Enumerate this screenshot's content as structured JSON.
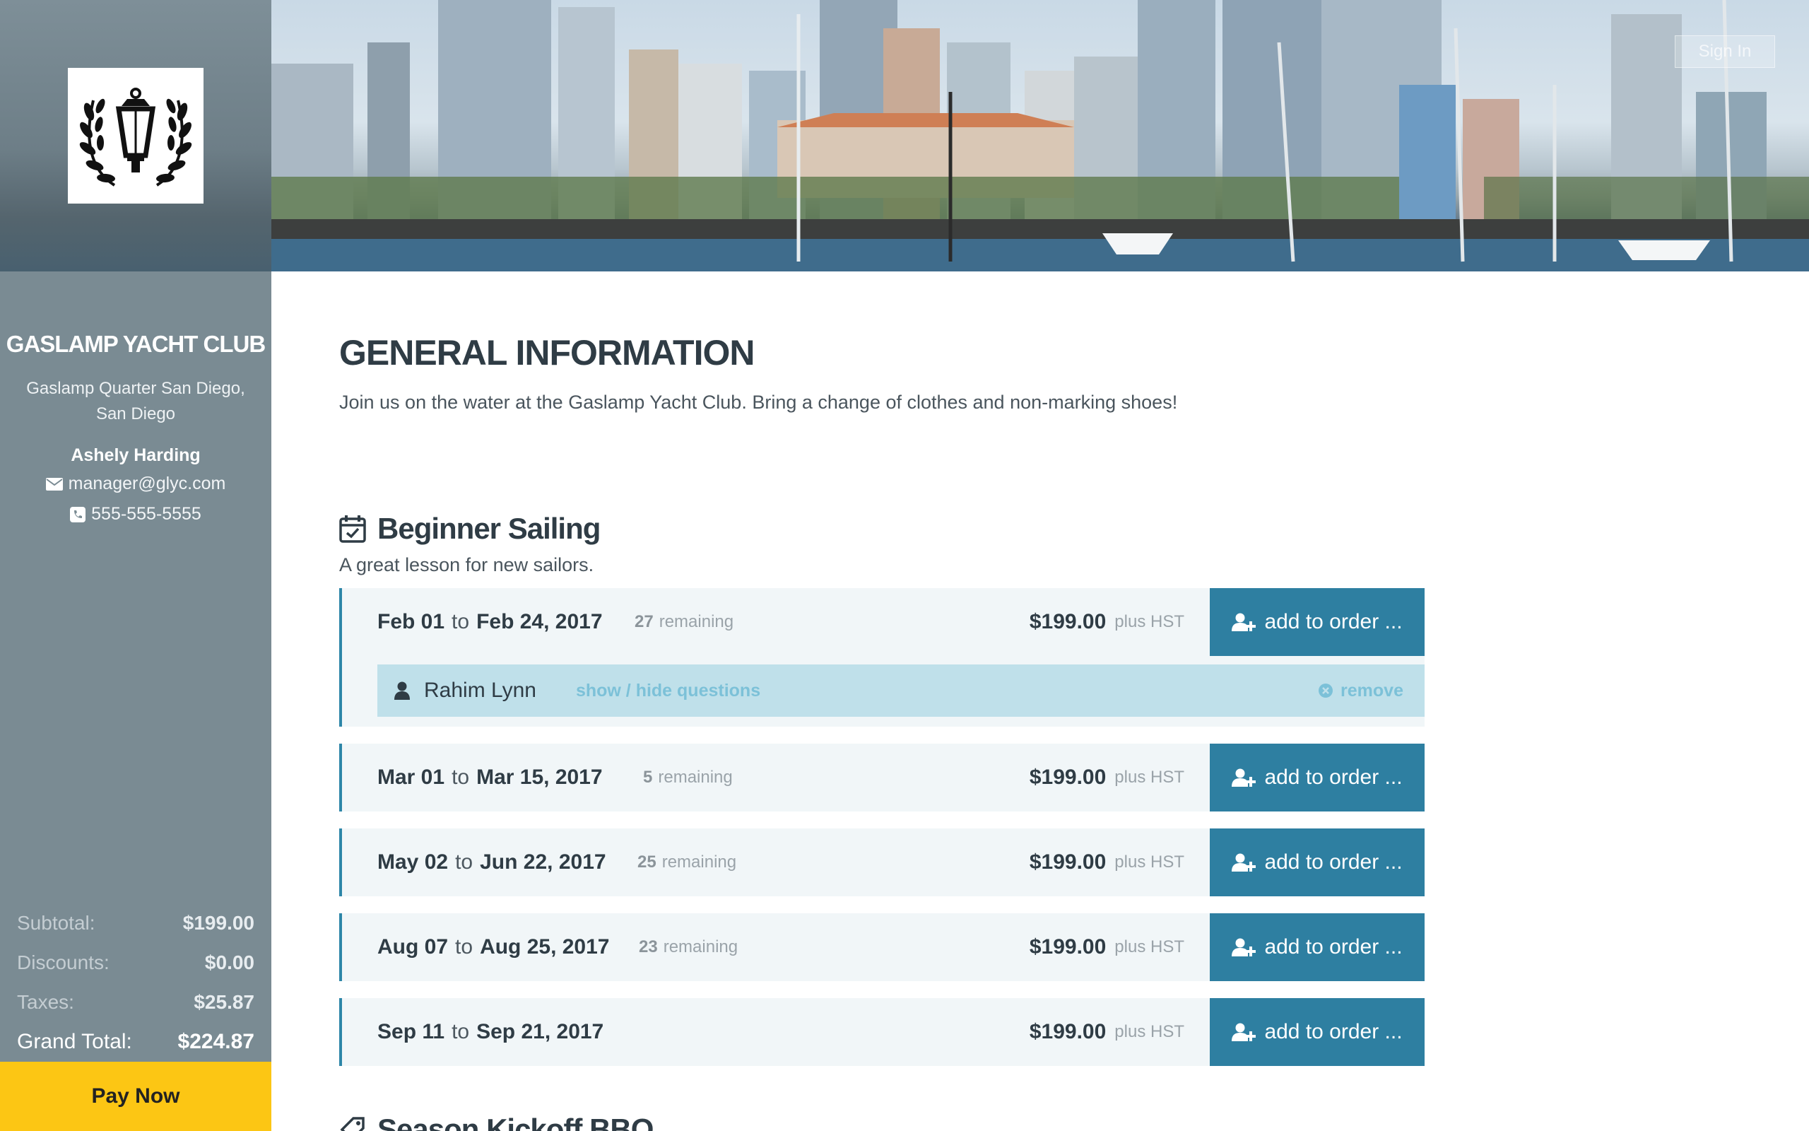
{
  "header": {
    "sign_in": "Sign In"
  },
  "sidebar": {
    "club_name": "GASLAMP YACHT CLUB",
    "address": "Gaslamp Quarter San Diego, San Diego",
    "manager": "Ashely Harding",
    "email": "manager@glyc.com",
    "phone": "555-555-5555",
    "totals": {
      "subtotal_label": "Subtotal:",
      "subtotal": "$199.00",
      "discounts_label": "Discounts:",
      "discounts": "$0.00",
      "taxes_label": "Taxes:",
      "taxes": "$25.87",
      "grand_label": "Grand Total:",
      "grand": "$224.87"
    },
    "pay_now": "Pay Now"
  },
  "main": {
    "title": "GENERAL INFORMATION",
    "description": "Join us on the water at the Gaslamp Yacht Club. Bring a change of clothes and non-marking shoes!",
    "course": {
      "title": "Beginner Sailing",
      "description": "A great lesson for new sailors.",
      "to_word": "to",
      "remaining_word": "remaining",
      "tax_label": "plus HST",
      "add_label": "add to order ...",
      "sessions": [
        {
          "start": "Feb 01",
          "end": "Feb 24, 2017",
          "remaining": "27",
          "price": "$199.00"
        },
        {
          "start": "Mar 01",
          "end": "Mar 15, 2017",
          "remaining": "5",
          "price": "$199.00"
        },
        {
          "start": "May 02",
          "end": "Jun 22, 2017",
          "remaining": "25",
          "price": "$199.00"
        },
        {
          "start": "Aug 07",
          "end": "Aug 25, 2017",
          "remaining": "23",
          "price": "$199.00"
        },
        {
          "start": "Sep 11",
          "end": "Sep 21, 2017",
          "remaining": "",
          "price": "$199.00"
        }
      ],
      "attendee": {
        "name": "Rahim Lynn",
        "toggle": "show / hide questions",
        "remove": "remove"
      }
    },
    "next_section_title": "Season Kickoff BBQ"
  }
}
